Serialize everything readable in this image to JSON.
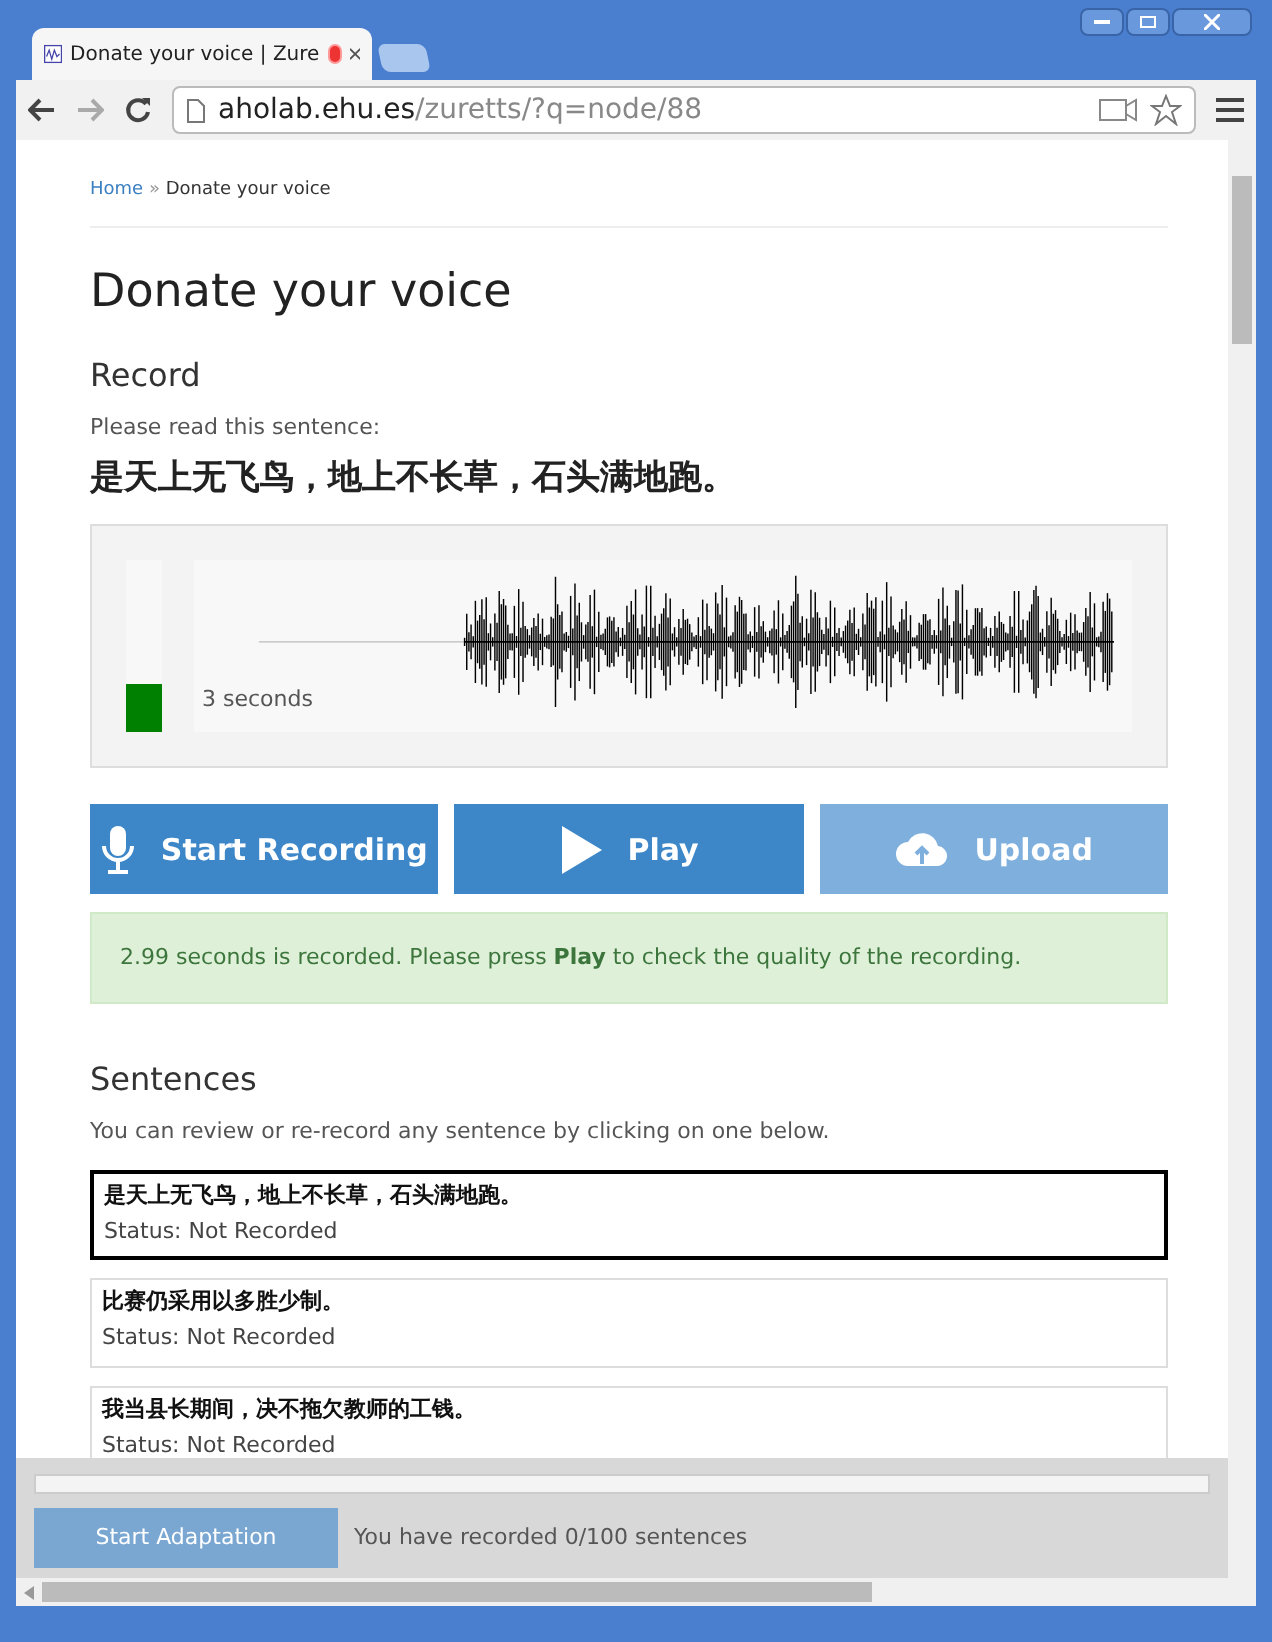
{
  "browser": {
    "tab": {
      "title": "Donate your voice | Zure",
      "recording": true
    },
    "address": {
      "host": "aholab.ehu.es",
      "path": "/zuretts/?q=node/88"
    }
  },
  "breadcrumb": {
    "home": "Home",
    "separator": "»",
    "current": "Donate your voice"
  },
  "title": "Donate your voice",
  "record": {
    "heading": "Record",
    "prompt": "Please read this sentence:",
    "sentence": "是天上无飞鸟，地上不长草，石头满地跑。",
    "meter": {
      "level": 0.28
    },
    "duration": "3 seconds"
  },
  "buttons": [
    {
      "kind": "mic",
      "label": "Start Recording",
      "disabled": false
    },
    {
      "kind": "play",
      "label": "Play",
      "disabled": false
    },
    {
      "kind": "upload",
      "label": "Upload",
      "disabled": true
    }
  ],
  "alert": "2.99 seconds is recorded. Please press **Play** to check the quality of the recording.",
  "sentences": {
    "heading": "Sentences",
    "hint": "You can review or re-record any sentence by clicking on one below.",
    "items": [
      {
        "text": "是天上无飞鸟，地上不长草，石头满地跑。",
        "status": "Status: Not Recorded",
        "selected": true
      },
      {
        "text": "比赛仍采用以多胜少制。",
        "status": "Status: Not Recorded",
        "selected": false
      },
      {
        "text": "我当县长期间，决不拖欠教师的工钱。",
        "status": "Status: Not Recorded",
        "selected": false
      }
    ]
  },
  "footer": {
    "progress": {
      "level": 0
    },
    "button": {
      "label": "Start Adaptation",
      "disabled": true
    },
    "summary": "You have recorded 0/100 sentences"
  }
}
